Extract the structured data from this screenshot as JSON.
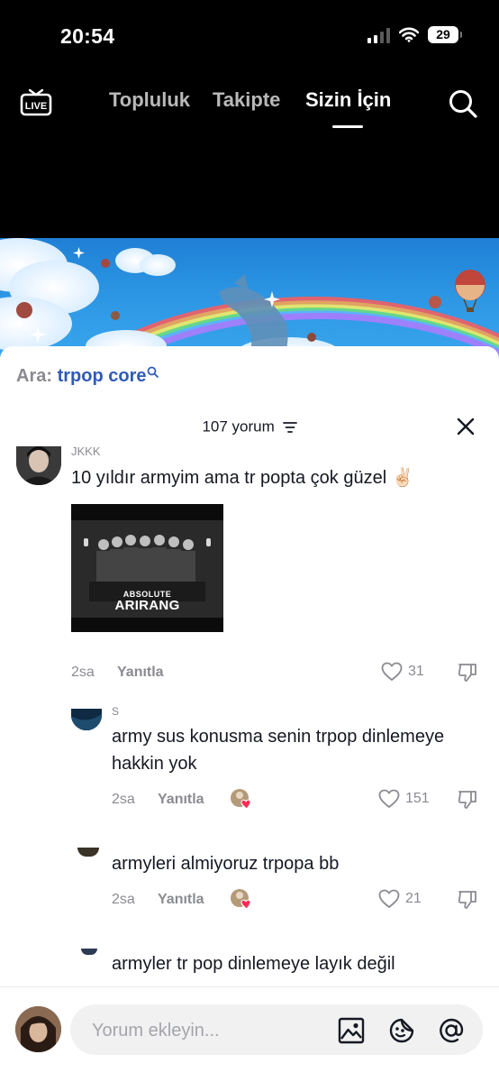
{
  "status_bar": {
    "time": "20:54",
    "battery": "29"
  },
  "top_nav": {
    "live_label": "LIVE",
    "tabs": [
      {
        "label": "Topluluk",
        "active": false
      },
      {
        "label": "Takipte",
        "active": false
      },
      {
        "label": "Sizin İçin",
        "active": true
      }
    ]
  },
  "search_suggestion": {
    "prefix": "Ara:",
    "query": "trpop core"
  },
  "comments_header": {
    "count_label": "107 yorum"
  },
  "comments": [
    {
      "username": "JKKK",
      "text": "10 yıldır armyim ama tr popta çok güzel",
      "emoji": "✌🏻",
      "attachment": {
        "caption_top": "ABSOLUTE",
        "caption_main": "ARIRANG"
      },
      "time": "2sa",
      "reply_label": "Yanıtla",
      "likes": "31"
    },
    {
      "username": "S",
      "text_line1": "army sus konusma senin trpop dinlemeye",
      "text_line2": "hakkin yok",
      "time": "2sa",
      "reply_label": "Yanıtla",
      "likes": "151"
    },
    {
      "text": "armyleri almiyoruz trpopa bb",
      "time": "2sa",
      "reply_label": "Yanıtla",
      "likes": "21"
    },
    {
      "text": "armyler tr pop dinlemeye layık değil"
    }
  ],
  "composer": {
    "placeholder": "Yorum ekleyin..."
  },
  "icons": {
    "live": "live-icon",
    "search": "search-icon",
    "sort": "sort-icon",
    "close": "close-icon",
    "like": "heart-icon",
    "dislike": "thumbs-down-icon",
    "image": "image-icon",
    "sticker": "sticker-icon",
    "mention": "at-sign-icon"
  },
  "colors": {
    "accent_link": "#2f5bb7",
    "liked_heart": "#fe2c55",
    "muted": "#8a8b91"
  }
}
